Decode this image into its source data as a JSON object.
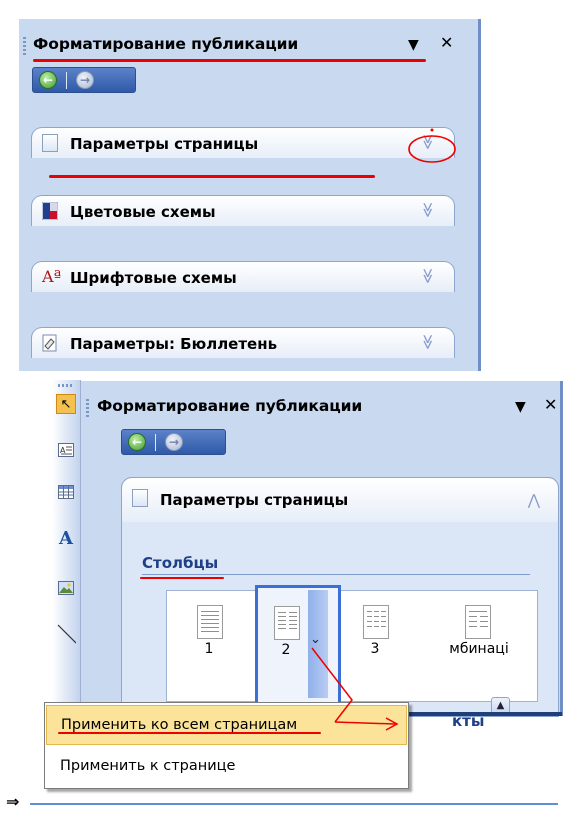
{
  "top_pane": {
    "title": "Форматирование публикации",
    "dropdown_glyph": "▼",
    "close_glyph": "✕",
    "nav": {
      "back_icon": "back-arrow-icon",
      "forward_icon": "forward-arrow-icon"
    },
    "sections": [
      {
        "label": "Параметры страницы",
        "icon": "page-icon"
      },
      {
        "label": "Цветовые схемы",
        "icon": "color-schemes-icon"
      },
      {
        "label": "Шрифтовые схемы",
        "icon": "font-schemes-icon",
        "icon_text": "Aª"
      },
      {
        "label": "Параметры: Бюллетень",
        "icon": "newsletter-options-icon"
      }
    ],
    "chevron": "≫"
  },
  "bottom_pane": {
    "title": "Форматирование публикации",
    "dropdown_glyph": "▼",
    "close_glyph": "✕",
    "section": {
      "label": "Параметры страницы",
      "chevron": "⋀"
    },
    "columns_heading": "Столбцы",
    "column_options": [
      {
        "label": "1",
        "cols": 1
      },
      {
        "label": "2",
        "cols": 2
      },
      {
        "label": "3",
        "cols": 3
      },
      {
        "label": "мбинаці",
        "cols": 2
      }
    ],
    "partial_heading_behind_menu": "кты"
  },
  "toolbar": {
    "tools": [
      "select-arrow-icon",
      "text-box-icon",
      "table-icon",
      "wordart-icon",
      "picture-icon",
      "line-icon"
    ]
  },
  "context_menu": {
    "items": [
      {
        "label": "Применить ко всем страницам",
        "highlighted": true
      },
      {
        "label": "Применить к странице",
        "highlighted": false
      }
    ]
  },
  "arrow_glyph": "⇒",
  "colors": {
    "pane_bg": "#c9daf0",
    "accent_blue": "#2f5aa8",
    "annotation_red": "#e00000",
    "menu_highlight": "#fbe39a"
  }
}
